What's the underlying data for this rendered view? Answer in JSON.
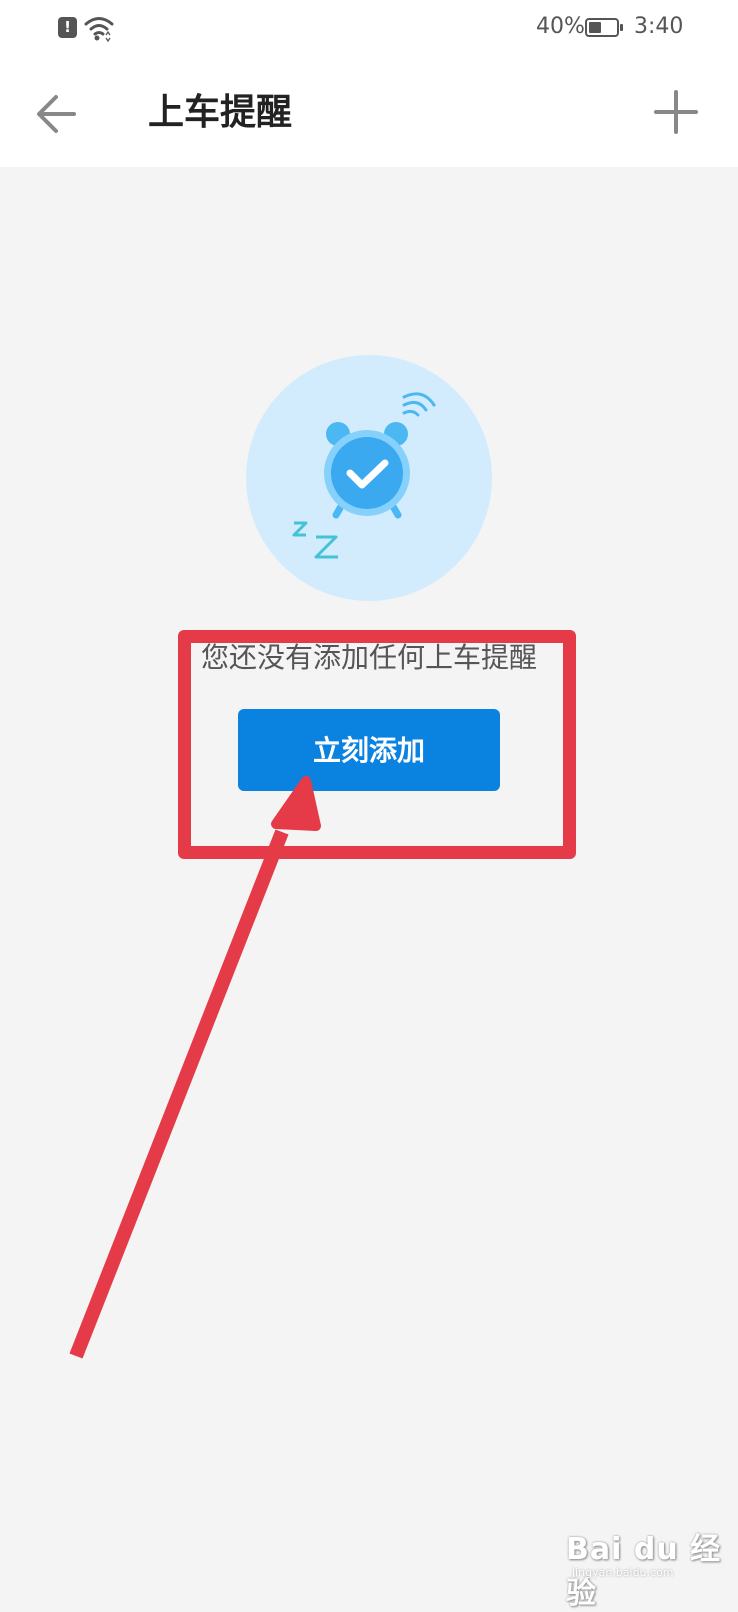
{
  "status_bar": {
    "battery_percent": "40%",
    "time": "3:40",
    "alert_glyph": "!"
  },
  "app_bar": {
    "title": "上车提醒",
    "back_icon": "arrow-left-icon",
    "add_icon": "plus-icon"
  },
  "empty_state": {
    "illustration": "alarm-clock-check-icon",
    "message": "您还没有添加任何上车提醒",
    "button_label": "立刻添加"
  },
  "annotation": {
    "highlight_color": "#e53a48"
  },
  "watermark": {
    "text": "Bai du 经验",
    "subtext": "jingyan.baidu.com"
  },
  "colors": {
    "accent": "#0a82e0",
    "illustration_bg": "#d3ecfd",
    "page_bg": "#f4f4f4"
  }
}
